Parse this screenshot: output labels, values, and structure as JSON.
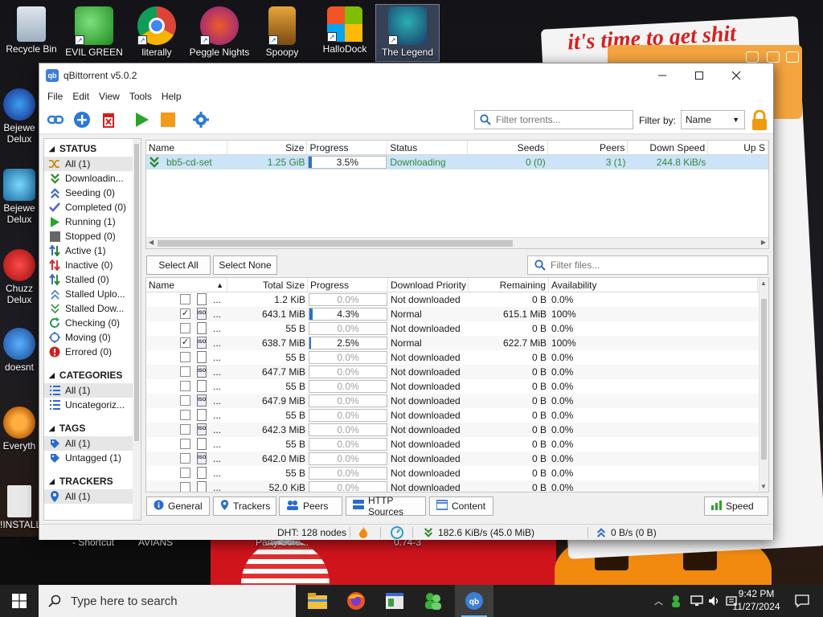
{
  "desktop": {
    "top_icons": [
      {
        "label": "Recycle Bin"
      },
      {
        "label": "EVIL GREEN"
      },
      {
        "label": "literally"
      },
      {
        "label": "Peggle Nights"
      },
      {
        "label": "Spoopy"
      },
      {
        "label": "HalloDock"
      },
      {
        "label": "The Legend"
      }
    ],
    "left_icons": [
      {
        "label": "Bejewe",
        "sub": "Delux"
      },
      {
        "label": "Bejewe",
        "sub": "Delux"
      },
      {
        "label": "Chuzz",
        "sub": "Delux"
      },
      {
        "label": "doesnt"
      },
      {
        "label": "Everyth"
      },
      {
        "label": "!INSTALL"
      }
    ],
    "wallpaper_text": "it's time to get shit",
    "bottom_labels": [
      "- Shortcut",
      "AVIANS",
      "Party Scre...",
      "0.74-3"
    ]
  },
  "window": {
    "title": "qBittorrent v5.0.2",
    "menu": [
      "File",
      "Edit",
      "View",
      "Tools",
      "Help"
    ],
    "filter_placeholder": "Filter torrents...",
    "filter_by_label": "Filter by:",
    "filter_by_value": "Name"
  },
  "sidebar": {
    "status_title": "STATUS",
    "status_items": [
      {
        "label": "All (1)",
        "icon": "shuffle-icon",
        "color": "#c98a10"
      },
      {
        "label": "Downloadin...",
        "icon": "download-icon",
        "color": "#2e8b2e"
      },
      {
        "label": "Seeding (0)",
        "icon": "upload-icon",
        "color": "#3a6bc8"
      },
      {
        "label": "Completed (0)",
        "icon": "check-icon",
        "color": "#5a63c8"
      },
      {
        "label": "Running (1)",
        "icon": "play-icon",
        "color": "#2aa52a"
      },
      {
        "label": "Stopped (0)",
        "icon": "stop-icon",
        "color": "#666666"
      },
      {
        "label": "Active (1)",
        "icon": "updown-icon",
        "color": "#2a7a3a"
      },
      {
        "label": "Inactive (0)",
        "icon": "updown-red-icon",
        "color": "#d03030"
      },
      {
        "label": "Stalled (0)",
        "icon": "stalled-icon",
        "color": "#3a6bc8"
      },
      {
        "label": "Stalled Uplo...",
        "icon": "stalled-up-icon",
        "color": "#3a6bc8"
      },
      {
        "label": "Stalled Dow...",
        "icon": "stalled-down-icon",
        "color": "#2e8b2e"
      },
      {
        "label": "Checking (0)",
        "icon": "refresh-icon",
        "color": "#2a9a4a"
      },
      {
        "label": "Moving (0)",
        "icon": "move-icon",
        "color": "#3a6bc8"
      },
      {
        "label": "Errored (0)",
        "icon": "error-icon",
        "color": "#d01e1e"
      }
    ],
    "categories_title": "CATEGORIES",
    "category_items": [
      {
        "label": "All (1)"
      },
      {
        "label": "Uncategoriz..."
      }
    ],
    "tags_title": "TAGS",
    "tag_items": [
      {
        "label": "All (1)"
      },
      {
        "label": "Untagged (1)"
      }
    ],
    "trackers_title": "TRACKERS",
    "tracker_items": [
      {
        "label": "All (1)"
      }
    ]
  },
  "torrents": {
    "columns": [
      "Name",
      "Size",
      "Progress",
      "Status",
      "Seeds",
      "Peers",
      "Down Speed",
      "Up S"
    ],
    "rows": [
      {
        "name": "bb5-cd-set",
        "size": "1.25 GiB",
        "progress": "3.5%",
        "progress_value": 0.035,
        "status": "Downloading",
        "seeds": "0 (0)",
        "peers": "3 (1)",
        "down_speed": "244.8 KiB/s"
      }
    ]
  },
  "file_controls": {
    "select_all": "Select All",
    "select_none": "Select None",
    "filter_placeholder": "Filter files..."
  },
  "files": {
    "columns": [
      "Name",
      "Total Size",
      "Progress",
      "Download Priority",
      "Remaining",
      "Availability"
    ],
    "rows": [
      {
        "checked": false,
        "type": "doc",
        "name": "...",
        "size": "1.2 KiB",
        "progress": "0.0%",
        "progress_value": 0,
        "priority": "Not downloaded",
        "remaining": "0 B",
        "availability": "0.0%"
      },
      {
        "checked": true,
        "type": "iso",
        "name": "...",
        "size": "643.1 MiB",
        "progress": "4.3%",
        "progress_value": 0.043,
        "priority": "Normal",
        "remaining": "615.1 MiB",
        "availability": "100%"
      },
      {
        "checked": false,
        "type": "doc",
        "name": "...",
        "size": "55 B",
        "progress": "0.0%",
        "progress_value": 0,
        "priority": "Not downloaded",
        "remaining": "0 B",
        "availability": "0.0%"
      },
      {
        "checked": true,
        "type": "iso",
        "name": "...",
        "size": "638.7 MiB",
        "progress": "2.5%",
        "progress_value": 0.025,
        "priority": "Normal",
        "remaining": "622.7 MiB",
        "availability": "100%"
      },
      {
        "checked": false,
        "type": "doc",
        "name": "...",
        "size": "55 B",
        "progress": "0.0%",
        "progress_value": 0,
        "priority": "Not downloaded",
        "remaining": "0 B",
        "availability": "0.0%"
      },
      {
        "checked": false,
        "type": "iso",
        "name": "...",
        "size": "647.7 MiB",
        "progress": "0.0%",
        "progress_value": 0,
        "priority": "Not downloaded",
        "remaining": "0 B",
        "availability": "0.0%"
      },
      {
        "checked": false,
        "type": "doc",
        "name": "...",
        "size": "55 B",
        "progress": "0.0%",
        "progress_value": 0,
        "priority": "Not downloaded",
        "remaining": "0 B",
        "availability": "0.0%"
      },
      {
        "checked": false,
        "type": "iso",
        "name": "...",
        "size": "647.9 MiB",
        "progress": "0.0%",
        "progress_value": 0,
        "priority": "Not downloaded",
        "remaining": "0 B",
        "availability": "0.0%"
      },
      {
        "checked": false,
        "type": "doc",
        "name": "...",
        "size": "55 B",
        "progress": "0.0%",
        "progress_value": 0,
        "priority": "Not downloaded",
        "remaining": "0 B",
        "availability": "0.0%"
      },
      {
        "checked": false,
        "type": "iso",
        "name": "...",
        "size": "642.3 MiB",
        "progress": "0.0%",
        "progress_value": 0,
        "priority": "Not downloaded",
        "remaining": "0 B",
        "availability": "0.0%"
      },
      {
        "checked": false,
        "type": "doc",
        "name": "...",
        "size": "55 B",
        "progress": "0.0%",
        "progress_value": 0,
        "priority": "Not downloaded",
        "remaining": "0 B",
        "availability": "0.0%"
      },
      {
        "checked": false,
        "type": "iso",
        "name": "...",
        "size": "642.0 MiB",
        "progress": "0.0%",
        "progress_value": 0,
        "priority": "Not downloaded",
        "remaining": "0 B",
        "availability": "0.0%"
      },
      {
        "checked": false,
        "type": "doc",
        "name": "...",
        "size": "55 B",
        "progress": "0.0%",
        "progress_value": 0,
        "priority": "Not downloaded",
        "remaining": "0 B",
        "availability": "0.0%"
      },
      {
        "checked": false,
        "type": "doc",
        "name": "...",
        "size": "52.0 KiB",
        "progress": "0.0%",
        "progress_value": 0,
        "priority": "Not downloaded",
        "remaining": "0 B",
        "availability": "0.0%"
      }
    ]
  },
  "tabs": [
    "General",
    "Trackers",
    "Peers",
    "HTTP Sources",
    "Content"
  ],
  "speed_button": "Speed",
  "statusbar": {
    "dht": "DHT: 128 nodes",
    "download": "182.6 KiB/s (45.0 MiB)",
    "upload": "0 B/s (0 B)"
  },
  "taskbar": {
    "search_placeholder": "Type here to search",
    "time": "9:42 PM",
    "date": "11/27/2024"
  }
}
